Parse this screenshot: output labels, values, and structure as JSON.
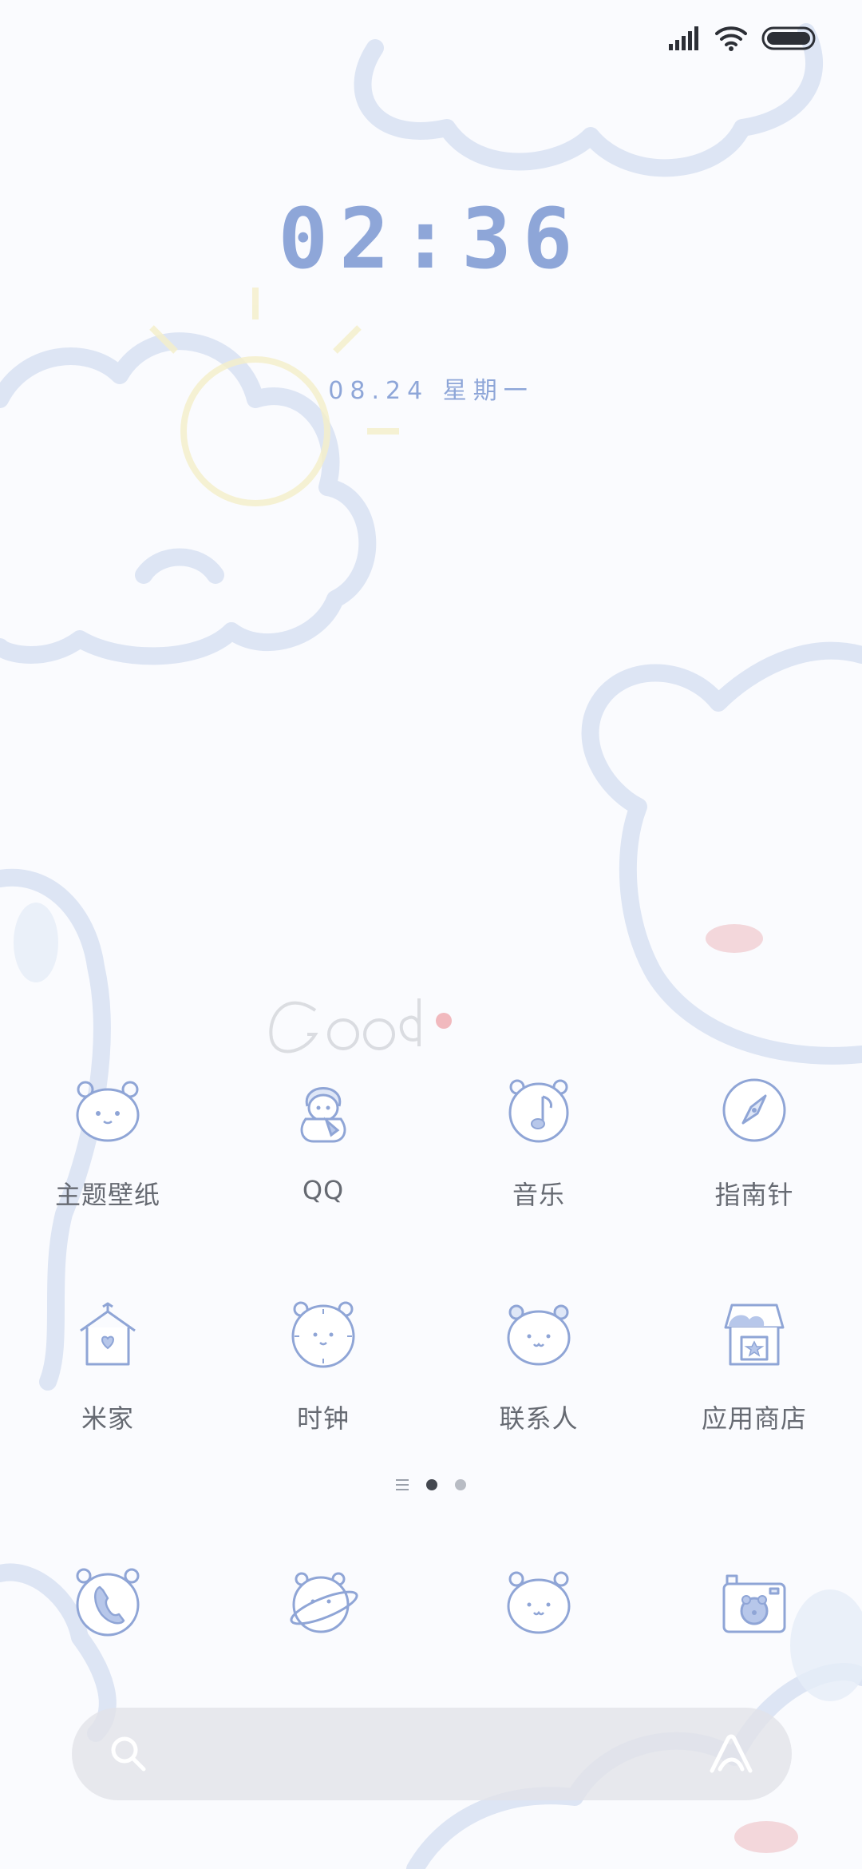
{
  "status_bar": {
    "signal_icon": "signal-bars-icon",
    "wifi_icon": "wifi-icon",
    "battery_icon": "battery-icon"
  },
  "lockscreen_clock": {
    "time": "02:36",
    "date": "08.24 星期一"
  },
  "wallpaper": {
    "theme": "blue-outline bears and clouds",
    "accent_color": "#8ea6d8"
  },
  "apps": [
    {
      "label": "主题壁纸",
      "icon": "bear-face-icon"
    },
    {
      "label": "QQ",
      "icon": "penguin-icon"
    },
    {
      "label": "音乐",
      "icon": "music-bear-icon"
    },
    {
      "label": "指南针",
      "icon": "compass-icon"
    },
    {
      "label": "米家",
      "icon": "home-heart-icon"
    },
    {
      "label": "时钟",
      "icon": "clock-bear-icon"
    },
    {
      "label": "联系人",
      "icon": "contacts-bear-icon"
    },
    {
      "label": "应用商店",
      "icon": "app-store-icon"
    }
  ],
  "page_indicator": {
    "pages": 2,
    "current_page": 1
  },
  "dock": [
    {
      "icon": "phone-icon"
    },
    {
      "icon": "browser-planet-icon"
    },
    {
      "icon": "messages-bear-icon"
    },
    {
      "icon": "camera-icon"
    }
  ],
  "search_bar": {
    "placeholder": "",
    "left_icon": "search-icon",
    "right_icon": "assistant-icon"
  }
}
